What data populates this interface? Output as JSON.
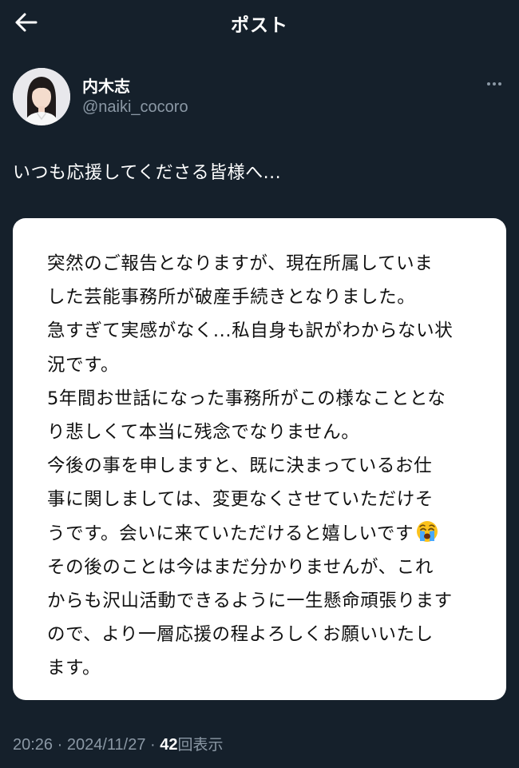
{
  "header": {
    "title": "ポスト",
    "back_icon": "arrow-left-icon"
  },
  "author": {
    "name": "内木志",
    "handle": "@naiki_cocoro",
    "more_icon": "more-horizontal-icon"
  },
  "post": {
    "text": "いつも応援してくださる皆様へ...",
    "image_text_lines": [
      "突然のご報告となりますが、現在所属していま",
      "した芸能事務所が破産手続きとなりました。",
      "急すぎて実感がなく...私自身も訳がわからない状",
      "況です。",
      "5年間お世話になった事務所がこの様なこととな",
      "り悲しくて本当に残念でなりません。",
      "今後の事を申しますと、既に決まっているお仕",
      "事に関しましては、変更なくさせていただけそ",
      "うです。会いに来ていただけると嬉しいです",
      "その後のことは今はまだ分かりませんが、これ",
      "からも沢山活動できるように一生懸命頑張ります",
      "ので、より一層応援の程よろしくお願いいたし",
      "ます。"
    ],
    "emoji": "loudly-crying-face"
  },
  "meta": {
    "time": "20:26",
    "separator": " · ",
    "date": "2024/11/27",
    "views_count": "42",
    "views_label": "回表示"
  },
  "colors": {
    "background": "#15202b",
    "secondary_text": "#8b98a5",
    "card_background": "#ffffff",
    "card_text": "#111111"
  }
}
